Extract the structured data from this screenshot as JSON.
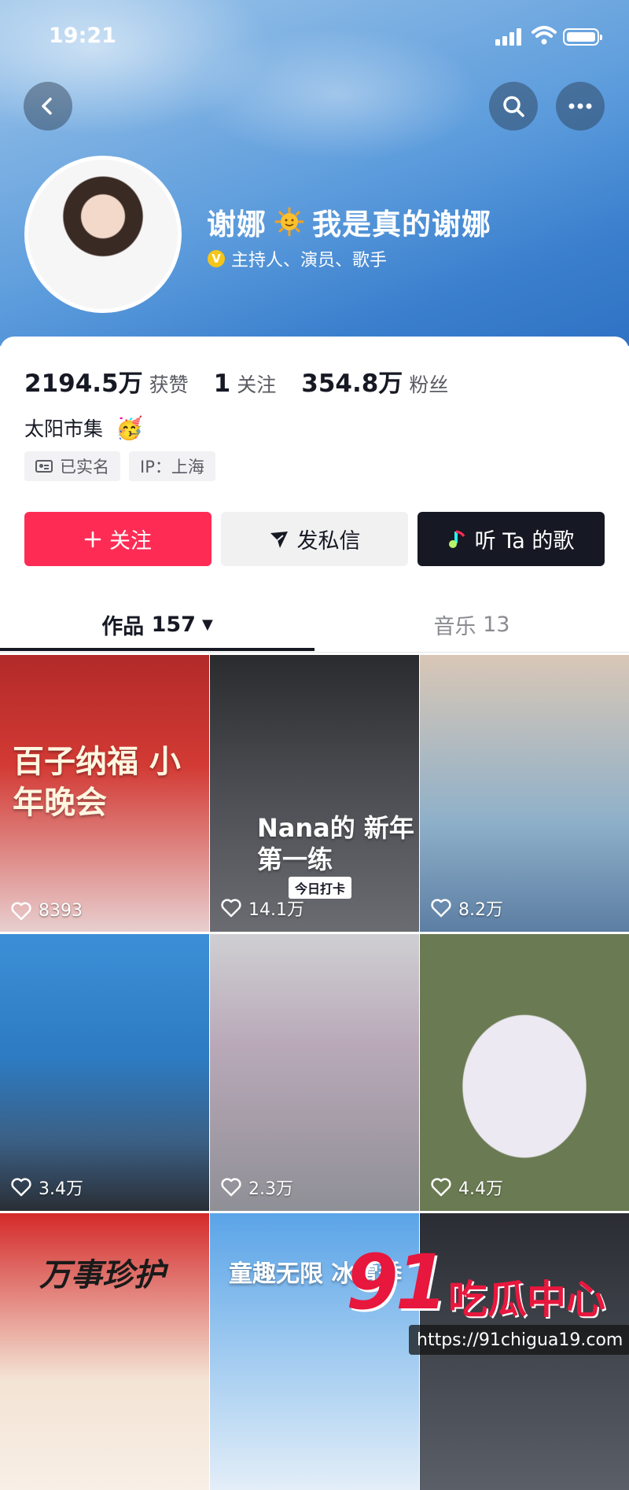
{
  "status_bar": {
    "time": "19:21"
  },
  "profile": {
    "name_part1": "谢娜",
    "name_part2": "我是真的谢娜",
    "verification": "主持人、演员、歌手",
    "verify_badge": "V"
  },
  "stats": [
    {
      "value": "2194.5万",
      "label": "获赞"
    },
    {
      "value": "1",
      "label": "关注"
    },
    {
      "value": "354.8万",
      "label": "粉丝"
    }
  ],
  "bio": "太阳市集",
  "tags": {
    "realname": "已实名",
    "ip": "IP：上海"
  },
  "actions": {
    "follow": "关注",
    "message": "发私信",
    "song": "听 Ta 的歌"
  },
  "tabs": {
    "works_label": "作品",
    "works_count": "157",
    "music_label": "音乐",
    "music_count": "13"
  },
  "videos": [
    {
      "likes": "8393",
      "overlay": "百子纳福 小年晚会"
    },
    {
      "likes": "14.1万",
      "overlay": "Nana的 新年第一练",
      "sub": "今日打卡"
    },
    {
      "likes": "8.2万"
    },
    {
      "likes": "3.4万"
    },
    {
      "likes": "2.3万"
    },
    {
      "likes": "4.4万"
    },
    {
      "overlay": "万事珍护"
    },
    {
      "overlay": "童趣无限 冰雪季"
    },
    {}
  ],
  "watermark": {
    "number": "91",
    "text": "吃瓜中心",
    "url": "https://91chigua19.com"
  },
  "colors": {
    "follow": "#fe2c55",
    "song_button": "#161823",
    "verify": "#f5c518"
  }
}
